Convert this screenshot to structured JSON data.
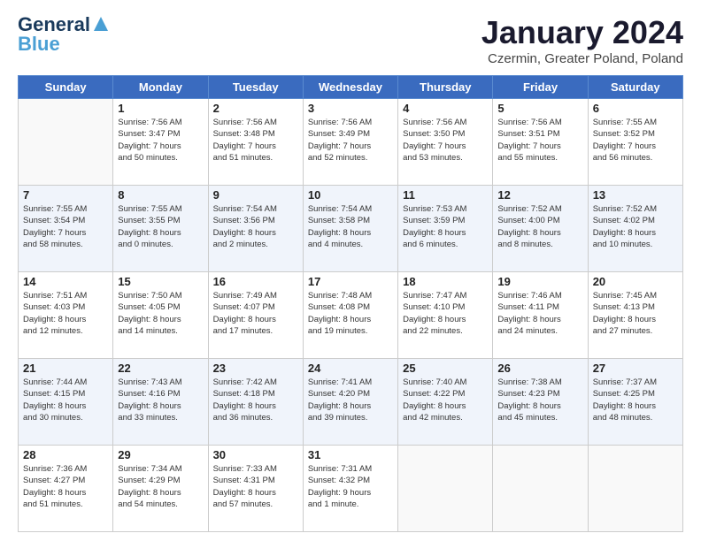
{
  "logo": {
    "line1": "General",
    "line2": "Blue"
  },
  "title": "January 2024",
  "subtitle": "Czermin, Greater Poland, Poland",
  "days": [
    "Sunday",
    "Monday",
    "Tuesday",
    "Wednesday",
    "Thursday",
    "Friday",
    "Saturday"
  ],
  "weeks": [
    [
      {
        "day": "",
        "info": ""
      },
      {
        "day": "1",
        "info": "Sunrise: 7:56 AM\nSunset: 3:47 PM\nDaylight: 7 hours\nand 50 minutes."
      },
      {
        "day": "2",
        "info": "Sunrise: 7:56 AM\nSunset: 3:48 PM\nDaylight: 7 hours\nand 51 minutes."
      },
      {
        "day": "3",
        "info": "Sunrise: 7:56 AM\nSunset: 3:49 PM\nDaylight: 7 hours\nand 52 minutes."
      },
      {
        "day": "4",
        "info": "Sunrise: 7:56 AM\nSunset: 3:50 PM\nDaylight: 7 hours\nand 53 minutes."
      },
      {
        "day": "5",
        "info": "Sunrise: 7:56 AM\nSunset: 3:51 PM\nDaylight: 7 hours\nand 55 minutes."
      },
      {
        "day": "6",
        "info": "Sunrise: 7:55 AM\nSunset: 3:52 PM\nDaylight: 7 hours\nand 56 minutes."
      }
    ],
    [
      {
        "day": "7",
        "info": "Sunrise: 7:55 AM\nSunset: 3:54 PM\nDaylight: 7 hours\nand 58 minutes."
      },
      {
        "day": "8",
        "info": "Sunrise: 7:55 AM\nSunset: 3:55 PM\nDaylight: 8 hours\nand 0 minutes."
      },
      {
        "day": "9",
        "info": "Sunrise: 7:54 AM\nSunset: 3:56 PM\nDaylight: 8 hours\nand 2 minutes."
      },
      {
        "day": "10",
        "info": "Sunrise: 7:54 AM\nSunset: 3:58 PM\nDaylight: 8 hours\nand 4 minutes."
      },
      {
        "day": "11",
        "info": "Sunrise: 7:53 AM\nSunset: 3:59 PM\nDaylight: 8 hours\nand 6 minutes."
      },
      {
        "day": "12",
        "info": "Sunrise: 7:52 AM\nSunset: 4:00 PM\nDaylight: 8 hours\nand 8 minutes."
      },
      {
        "day": "13",
        "info": "Sunrise: 7:52 AM\nSunset: 4:02 PM\nDaylight: 8 hours\nand 10 minutes."
      }
    ],
    [
      {
        "day": "14",
        "info": "Sunrise: 7:51 AM\nSunset: 4:03 PM\nDaylight: 8 hours\nand 12 minutes."
      },
      {
        "day": "15",
        "info": "Sunrise: 7:50 AM\nSunset: 4:05 PM\nDaylight: 8 hours\nand 14 minutes."
      },
      {
        "day": "16",
        "info": "Sunrise: 7:49 AM\nSunset: 4:07 PM\nDaylight: 8 hours\nand 17 minutes."
      },
      {
        "day": "17",
        "info": "Sunrise: 7:48 AM\nSunset: 4:08 PM\nDaylight: 8 hours\nand 19 minutes."
      },
      {
        "day": "18",
        "info": "Sunrise: 7:47 AM\nSunset: 4:10 PM\nDaylight: 8 hours\nand 22 minutes."
      },
      {
        "day": "19",
        "info": "Sunrise: 7:46 AM\nSunset: 4:11 PM\nDaylight: 8 hours\nand 24 minutes."
      },
      {
        "day": "20",
        "info": "Sunrise: 7:45 AM\nSunset: 4:13 PM\nDaylight: 8 hours\nand 27 minutes."
      }
    ],
    [
      {
        "day": "21",
        "info": "Sunrise: 7:44 AM\nSunset: 4:15 PM\nDaylight: 8 hours\nand 30 minutes."
      },
      {
        "day": "22",
        "info": "Sunrise: 7:43 AM\nSunset: 4:16 PM\nDaylight: 8 hours\nand 33 minutes."
      },
      {
        "day": "23",
        "info": "Sunrise: 7:42 AM\nSunset: 4:18 PM\nDaylight: 8 hours\nand 36 minutes."
      },
      {
        "day": "24",
        "info": "Sunrise: 7:41 AM\nSunset: 4:20 PM\nDaylight: 8 hours\nand 39 minutes."
      },
      {
        "day": "25",
        "info": "Sunrise: 7:40 AM\nSunset: 4:22 PM\nDaylight: 8 hours\nand 42 minutes."
      },
      {
        "day": "26",
        "info": "Sunrise: 7:38 AM\nSunset: 4:23 PM\nDaylight: 8 hours\nand 45 minutes."
      },
      {
        "day": "27",
        "info": "Sunrise: 7:37 AM\nSunset: 4:25 PM\nDaylight: 8 hours\nand 48 minutes."
      }
    ],
    [
      {
        "day": "28",
        "info": "Sunrise: 7:36 AM\nSunset: 4:27 PM\nDaylight: 8 hours\nand 51 minutes."
      },
      {
        "day": "29",
        "info": "Sunrise: 7:34 AM\nSunset: 4:29 PM\nDaylight: 8 hours\nand 54 minutes."
      },
      {
        "day": "30",
        "info": "Sunrise: 7:33 AM\nSunset: 4:31 PM\nDaylight: 8 hours\nand 57 minutes."
      },
      {
        "day": "31",
        "info": "Sunrise: 7:31 AM\nSunset: 4:32 PM\nDaylight: 9 hours\nand 1 minute."
      },
      {
        "day": "",
        "info": ""
      },
      {
        "day": "",
        "info": ""
      },
      {
        "day": "",
        "info": ""
      }
    ]
  ]
}
